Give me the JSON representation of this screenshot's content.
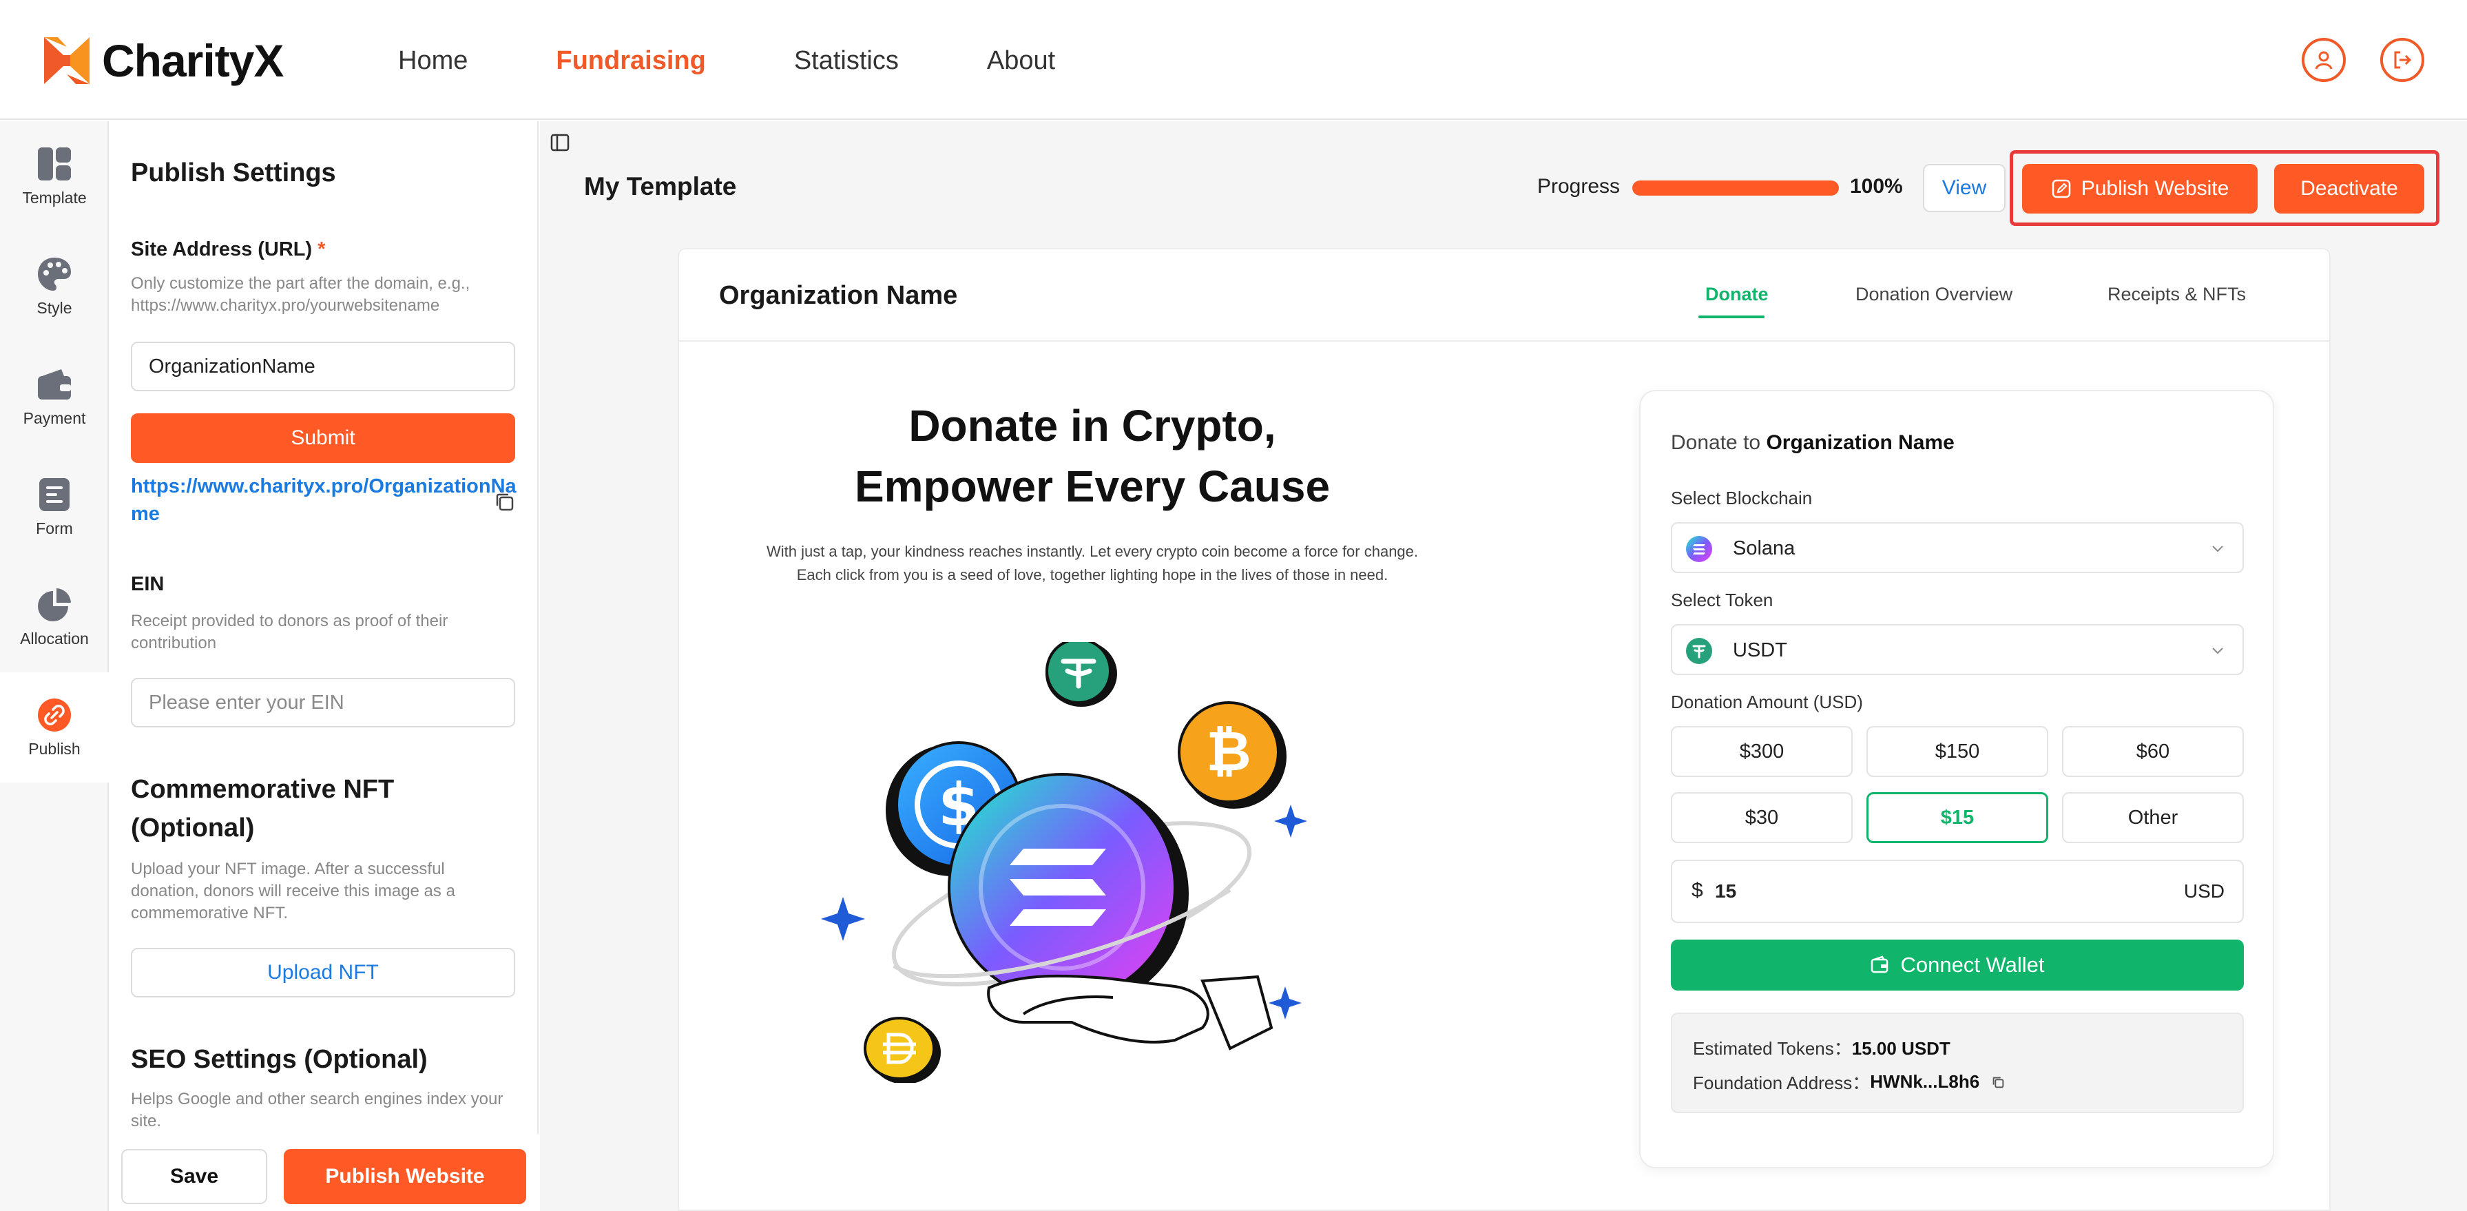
{
  "brand": {
    "name": "CharityX",
    "accent": "#f05a28",
    "success": "#10b56b",
    "link": "#1a7ae0"
  },
  "nav": {
    "items": [
      {
        "label": "Home"
      },
      {
        "label": "Fundraising",
        "active": true
      },
      {
        "label": "Statistics"
      },
      {
        "label": "About"
      }
    ],
    "icons": [
      "user-icon",
      "logout-icon"
    ]
  },
  "rail": {
    "items": [
      {
        "label": "Template",
        "icon": "template-icon"
      },
      {
        "label": "Style",
        "icon": "palette-icon"
      },
      {
        "label": "Payment",
        "icon": "wallet-icon"
      },
      {
        "label": "Form",
        "icon": "form-icon"
      },
      {
        "label": "Allocation",
        "icon": "pie-chart-icon"
      },
      {
        "label": "Publish",
        "icon": "link-icon",
        "active": true
      }
    ]
  },
  "settings": {
    "title": "Publish Settings",
    "site_address": {
      "label": "Site Address (URL)",
      "required_mark": "*",
      "hint": "Only customize the part after the domain, e.g., https://www.charityx.pro/yourwebsitename",
      "value": "OrganizationName",
      "submit_label": "Submit",
      "url": "https://www.charityx.pro/OrganizationName"
    },
    "ein": {
      "label": "EIN",
      "hint": "Receipt provided to donors as proof of their contribution",
      "placeholder": "Please enter your EIN"
    },
    "nft": {
      "title": "Commemorative NFT (Optional)",
      "hint": "Upload your NFT image. After a successful donation, donors will receive this image as a commemorative NFT.",
      "upload_label": "Upload NFT"
    },
    "seo": {
      "title": "SEO Settings (Optional)",
      "hint": "Helps Google and other search engines index your site."
    },
    "save_label": "Save",
    "publish_label": "Publish Website"
  },
  "main": {
    "page_title": "My Template",
    "progress_label": "Progress",
    "progress_value": 100,
    "progress_text": "100%",
    "view_label": "View",
    "publish_label": "Publish Website",
    "deactivate_label": "Deactivate"
  },
  "preview": {
    "org_name": "Organization Name",
    "tabs": [
      {
        "label": "Donate",
        "active": true
      },
      {
        "label": "Donation Overview"
      },
      {
        "label": "Receipts & NFTs"
      }
    ],
    "hero_title_line1": "Donate in Crypto,",
    "hero_title_line2": "Empower Every Cause",
    "hero_sub_line1": "With just a tap, your kindness reaches instantly. Let every crypto coin become a force for change.",
    "hero_sub_line2": "Each click from you is a seed of love, together lighting hope in the lives of those in need.",
    "widget": {
      "title_prefix": "Donate to",
      "title_org": "Organization Name",
      "blockchain_label": "Select Blockchain",
      "blockchain_value": "Solana",
      "token_label": "Select Token",
      "token_value": "USDT",
      "amount_label": "Donation Amount (USD)",
      "amounts": [
        "$300",
        "$150",
        "$60",
        "$30",
        "$15",
        "Other"
      ],
      "selected_amount": "$15",
      "currency_symbol": "$",
      "amount_value": "15",
      "unit": "USD",
      "connect_label": "Connect Wallet",
      "estimated_label": "Estimated Tokens：",
      "estimated_value": "15.00 USDT",
      "address_label": "Foundation Address：",
      "address_value": "HWNk...L8h6"
    }
  }
}
